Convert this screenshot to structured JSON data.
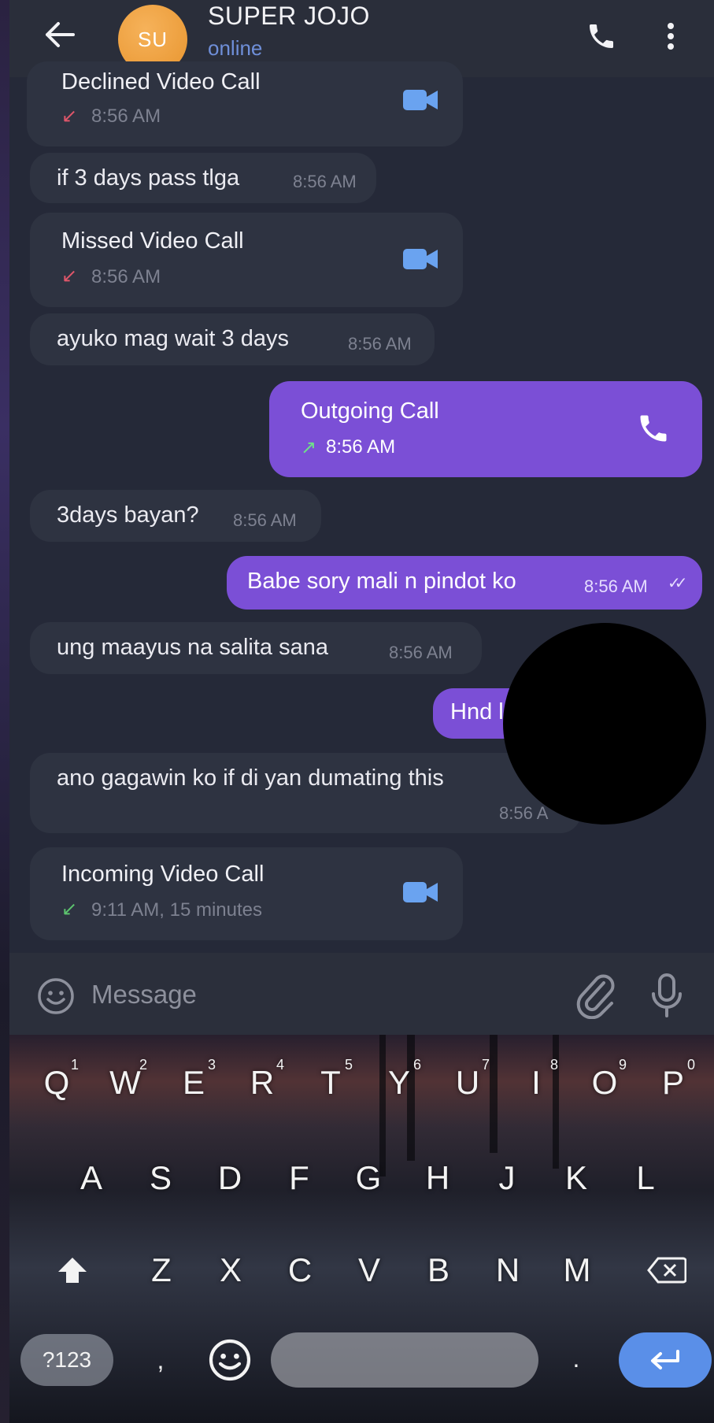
{
  "header": {
    "avatar_initials": "SU",
    "contact_name": "SUPER JOJO",
    "status": "online"
  },
  "messages": [
    {
      "kind": "call",
      "direction": "in",
      "title": "Declined Video Call",
      "arrow": "↙",
      "arrow_color": "#e0566a",
      "time": "8:56 AM"
    },
    {
      "kind": "text",
      "direction": "in",
      "text": "if 3 days pass tlga",
      "time": "8:56 AM"
    },
    {
      "kind": "call",
      "direction": "in",
      "title": "Missed Video Call",
      "arrow": "↙",
      "arrow_color": "#e0566a",
      "time": "8:56 AM"
    },
    {
      "kind": "text",
      "direction": "in",
      "text": "ayuko mag wait 3 days",
      "time": "8:56 AM"
    },
    {
      "kind": "call",
      "direction": "out",
      "title": "Outgoing Call",
      "arrow": "↗",
      "arrow_color": "#6fe08a",
      "time": "8:56 AM"
    },
    {
      "kind": "text",
      "direction": "in",
      "text": "3days bayan?",
      "time": "8:56 AM"
    },
    {
      "kind": "text",
      "direction": "out",
      "text": "Babe sory mali n pindot ko",
      "time": "8:56 AM",
      "ticks": "✓✓"
    },
    {
      "kind": "text",
      "direction": "in",
      "text": "ung maayus na salita sana",
      "time": "8:56 AM"
    },
    {
      "kind": "text",
      "direction": "out",
      "text": "Hnd l"
    },
    {
      "kind": "text",
      "direction": "in",
      "text": "ano gagawin ko if di yan dumating this",
      "time": "8:56 A"
    },
    {
      "kind": "call",
      "direction": "in",
      "title": "Incoming Video Call",
      "arrow": "↙",
      "arrow_color": "#5cc46e",
      "time": "9:11 AM, 15 minutes"
    }
  ],
  "composer": {
    "placeholder": "Message"
  },
  "keyboard": {
    "row1": [
      [
        "Q",
        "1"
      ],
      [
        "W",
        "2"
      ],
      [
        "E",
        "3"
      ],
      [
        "R",
        "4"
      ],
      [
        "T",
        "5"
      ],
      [
        "Y",
        "6"
      ],
      [
        "U",
        "7"
      ],
      [
        "I",
        "8"
      ],
      [
        "O",
        "9"
      ],
      [
        "P",
        "0"
      ]
    ],
    "row2": [
      "A",
      "S",
      "D",
      "F",
      "G",
      "H",
      "J",
      "K",
      "L"
    ],
    "row3": [
      "Z",
      "X",
      "C",
      "V",
      "B",
      "N",
      "M"
    ],
    "symbols_label": "?123",
    "comma": ",",
    "period": "."
  },
  "colors": {
    "outgoing_bubble": "#7b4fd6",
    "incoming_bubble": "#2e3341",
    "status_online": "#6f8fd9",
    "avatar": "#f0a445",
    "video_icon": "#6aa3f0",
    "enter_key": "#5a8fe8"
  },
  "icons": [
    "back-arrow-icon",
    "phone-icon",
    "more-vertical-icon",
    "video-camera-icon",
    "emoji-icon",
    "paperclip-icon",
    "microphone-icon",
    "shift-icon",
    "backspace-icon",
    "enter-icon"
  ]
}
